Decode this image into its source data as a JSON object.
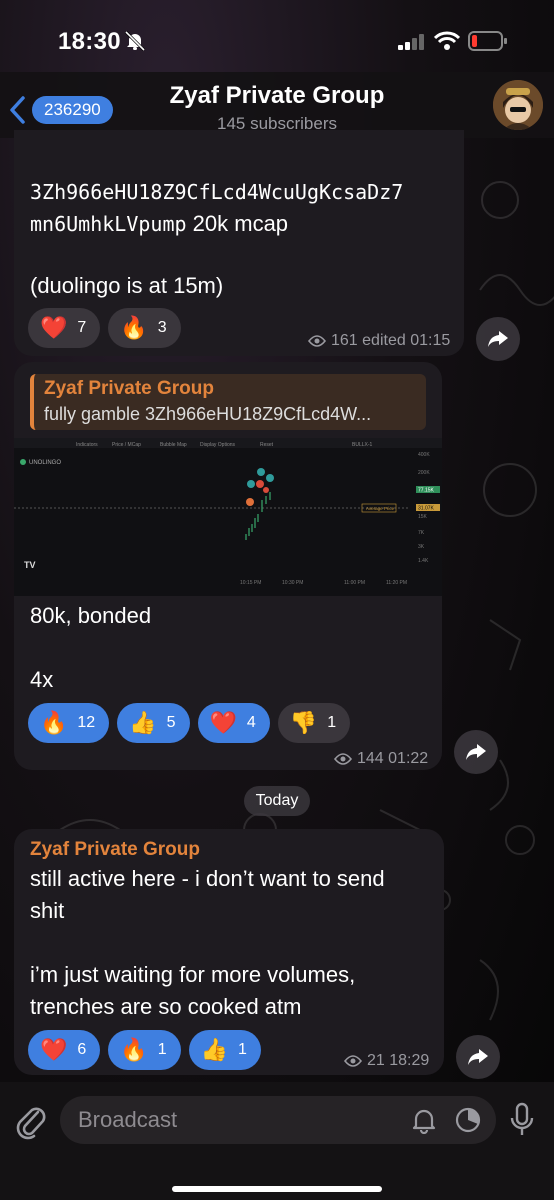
{
  "status": {
    "time": "18:30"
  },
  "header": {
    "back_count": "236290",
    "title": "Zyaf Private Group",
    "subtitle": "145 subscribers"
  },
  "messages": [
    {
      "mono_line1": "3Zh966eHU18Z9CfLcd4WcuUgKcsaDz7",
      "mono_line2": "mn6UmhkLVpump",
      "line2_tail": " 20k mcap",
      "text2": "(duolingo is at 15m)",
      "reactions": [
        {
          "emoji": "❤️",
          "count": "7"
        },
        {
          "emoji": "🔥",
          "count": "3"
        }
      ],
      "views": "161",
      "meta": "edited 01:15"
    },
    {
      "reply_author": "Zyaf Private Group",
      "reply_text": "fully gamble 3Zh966eHU18Z9CfLcd4W...",
      "text1": "80k, bonded",
      "text2": "4x",
      "reactions": [
        {
          "emoji": "🔥",
          "count": "12"
        },
        {
          "emoji": "👍",
          "count": "5"
        },
        {
          "emoji": "❤️",
          "count": "4"
        },
        {
          "emoji": "👎",
          "count": "1"
        }
      ],
      "views": "144",
      "meta": "01:22"
    },
    {
      "author": "Zyaf Private Group",
      "line1": "still active here - i don’t want to send",
      "line2": "shit",
      "line3": "i’m just waiting for more volumes,",
      "line4": "trenches are so cooked atm",
      "reactions": [
        {
          "emoji": "❤️",
          "count": "6"
        },
        {
          "emoji": "🔥",
          "count": "1"
        },
        {
          "emoji": "👍",
          "count": "1"
        }
      ],
      "views": "21",
      "meta": "18:29"
    }
  ],
  "date_separator": "Today",
  "chart_preview": {
    "ticker": "UNOLINGO",
    "toolbar": [
      "Indicators",
      "Price / MCap",
      "Bubble Map",
      "Display Options",
      "Reset"
    ],
    "symbol": "BULLX-1",
    "y_ticks": [
      "400K",
      "200K",
      "77.15K",
      "31.07K",
      "15K",
      "7K",
      "3K",
      "1.4K"
    ],
    "x_ticks": [
      "10:15 PM",
      "10:30 PM",
      "11:00 PM",
      "11:20 PM"
    ],
    "avg_label": "Average Price"
  },
  "input": {
    "placeholder": "Broadcast"
  },
  "colors": {
    "accent": "#3f7fe0",
    "author": "#e3843c",
    "bubble": "#1e1b20"
  }
}
